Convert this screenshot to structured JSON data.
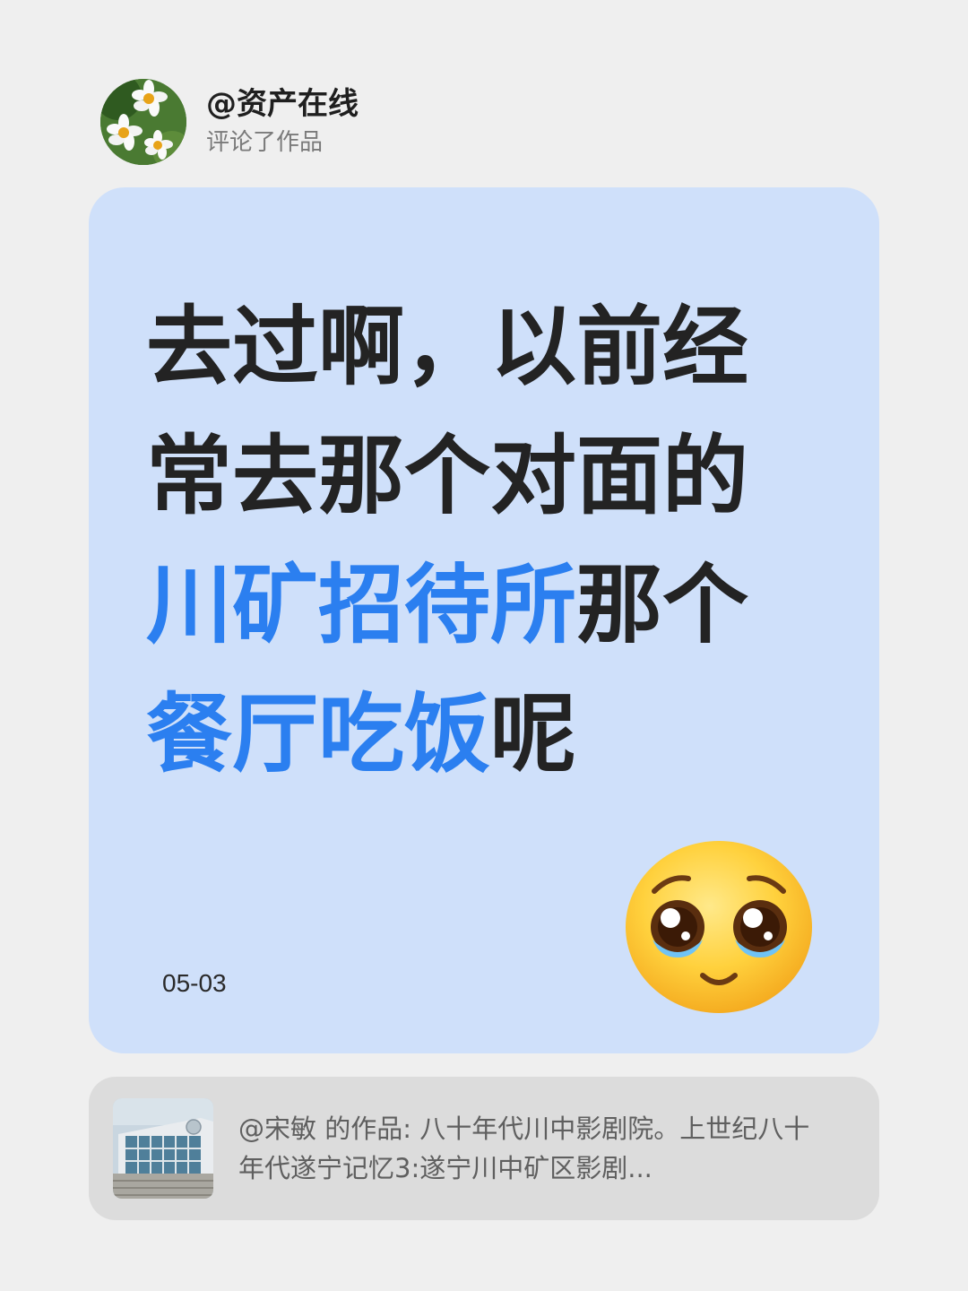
{
  "header": {
    "username": "@资产在线",
    "action": "评论了作品",
    "avatar_icon": "daisy-flowers-avatar"
  },
  "comment": {
    "segments": [
      {
        "text": "去过啊，以前经常去那个对面的",
        "highlight": false
      },
      {
        "text": "川矿招待所",
        "highlight": true
      },
      {
        "text": "那个",
        "highlight": false
      },
      {
        "text": "餐厅吃饭",
        "highlight": true
      },
      {
        "text": "呢",
        "highlight": false
      }
    ],
    "date": "05-03",
    "emoji": "pleading-face-emoji"
  },
  "source": {
    "text": "@宋敏  的作品: 八十年代川中影剧院。上世纪八十年代遂宁记忆3:遂宁川中矿区影剧...",
    "thumbnail_icon": "building-thumbnail"
  },
  "colors": {
    "background": "#efefef",
    "card": "#cfe0fa",
    "highlight": "#2b7ff0",
    "text_dark": "#232323",
    "source_card": "#dcdcdc"
  }
}
